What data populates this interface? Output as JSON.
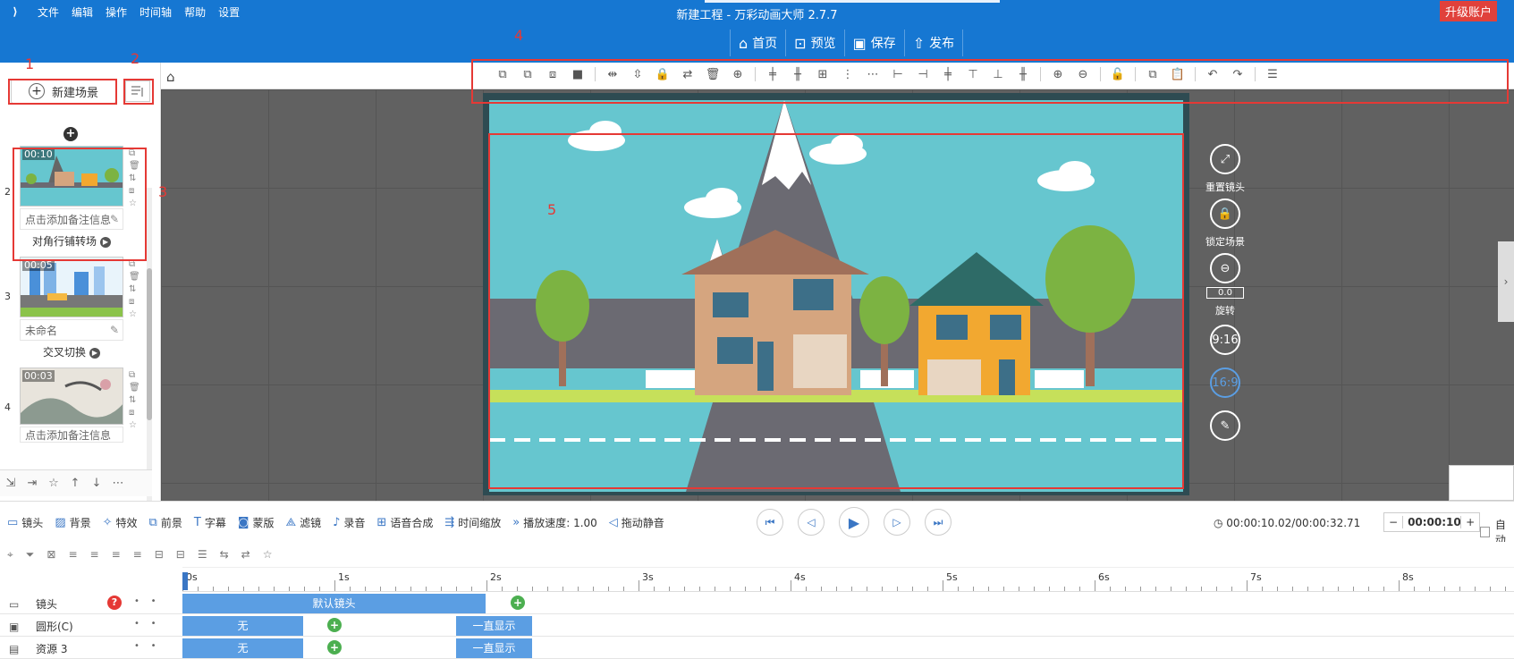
{
  "app": {
    "title": "新建工程 - 万彩动画大师 2.7.7",
    "upgrade": "升级账户"
  },
  "menu": [
    "文件",
    "编辑",
    "操作",
    "时间轴",
    "帮助",
    "设置"
  ],
  "mainbar": [
    {
      "label": "首页",
      "icon": "home-icon"
    },
    {
      "label": "预览",
      "icon": "preview-icon"
    },
    {
      "label": "保存",
      "icon": "save-icon"
    },
    {
      "label": "发布",
      "icon": "publish-icon"
    }
  ],
  "annotations": {
    "n1": "1",
    "n2": "2",
    "n3": "3",
    "n4": "4",
    "n5": "5"
  },
  "left": {
    "new_scene": "新建场景",
    "scenes": [
      {
        "num": "2",
        "duration": "00:10",
        "note": "点击添加备注信息",
        "transition": "对角行铺转场"
      },
      {
        "num": "3",
        "duration": "00:05",
        "note": "未命名",
        "transition": "交叉切换"
      },
      {
        "num": "4",
        "duration": "00:03",
        "note": "点击添加备注信息",
        "transition": ""
      }
    ]
  },
  "right_controls": {
    "reset_camera": "重置镜头",
    "lock_scene": "锁定场景",
    "rotation_value": "0.0",
    "rotate": "旋转",
    "ratio_916": "9:16",
    "ratio_169": "16:9"
  },
  "playbar": {
    "tabs": [
      "镜头",
      "背景",
      "特效",
      "前景",
      "字幕",
      "蒙版",
      "滤镜",
      "录音",
      "语音合成",
      "时间缩放",
      "播放速度: 1.00",
      "拖动静音"
    ],
    "time": "00:00:10.02/00:00:32.71",
    "zoom_value": "00:00:10.0",
    "auto_label": "自动"
  },
  "ruler": [
    "0s",
    "1s",
    "2s",
    "3s",
    "4s",
    "5s",
    "6s",
    "7s",
    "8s"
  ],
  "tracks": [
    {
      "name": "镜头",
      "bars": [
        {
          "label": "默认镜头"
        }
      ]
    },
    {
      "name": "圆形(C)",
      "bars": [
        {
          "label": "无"
        },
        {
          "label": "一直显示"
        }
      ]
    },
    {
      "name": "资源 3",
      "bars": [
        {
          "label": "无"
        },
        {
          "label": "一直显示"
        }
      ]
    }
  ],
  "colors": {
    "titlebar": "#1677d2",
    "annotation": "#e53935",
    "timeline_bar": "#5b9ee3",
    "keyframe": "#4caf50"
  }
}
